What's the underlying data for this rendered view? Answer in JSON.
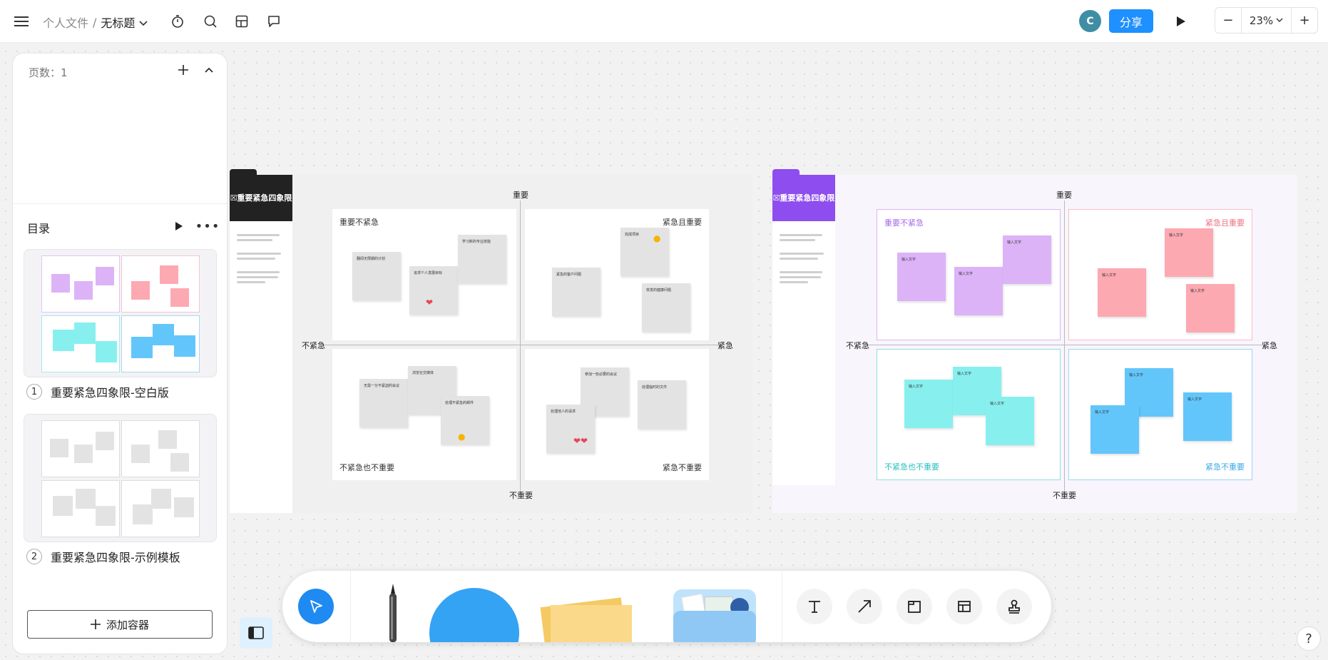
{
  "header": {
    "breadcrumb_root": "个人文件",
    "breadcrumb_sep": "/",
    "document_title": "无标题",
    "avatar_initial": "C",
    "share_label": "分享",
    "zoom_minus": "−",
    "zoom_level": "23%",
    "zoom_plus": "+"
  },
  "sidebar": {
    "page_count": "页数：1",
    "toc_title": "目录",
    "toc_more": "•••",
    "pages": [
      {
        "num": "1",
        "title": "重要紧急四象限-空白版"
      },
      {
        "num": "2",
        "title": "重要紧急四象限-示例模板"
      }
    ],
    "add_container": "添加容器"
  },
  "canvas": {
    "frames": [
      {
        "tab_title": "☒重要紧急四象限",
        "accent": "#222222",
        "axis_top": "重要",
        "axis_bottom": "不重要",
        "axis_left": "不紧急",
        "axis_right": "紧急",
        "q_tl": "重要不紧急",
        "q_tr": "紧急且重要",
        "q_bl": "不紧急也不重要",
        "q_br": "紧急不重要",
        "notes_tl": [
          "翻阅无限期的计划",
          "追求个人发展目标",
          "学习新的专业技能"
        ],
        "notes_tr": [
          "紧急的客户问题",
          "完成项目",
          "突发的健康问题"
        ],
        "notes_bl": [
          "无需一分不紧迫的会议",
          "浏览社交媒体",
          "处理不紧急的邮件"
        ],
        "notes_br": [
          "参加一些必要的会议",
          "处理他人的请求",
          "处理临时的文件"
        ]
      },
      {
        "tab_title": "☒重要紧急四象限",
        "accent": "#8e4dee",
        "axis_top": "重要",
        "axis_bottom": "不重要",
        "axis_left": "不紧急",
        "axis_right": "紧急",
        "q_tl": "重要不紧急",
        "q_tr": "紧急且重要",
        "q_bl": "不紧急也不重要",
        "q_br": "紧急不重要",
        "placeholder": "输入文字"
      }
    ]
  },
  "colors": {
    "accent_blue": "#1e90ff",
    "note_gray": "#e3e3e3",
    "note_purple": "#ddb3f8",
    "note_pink": "#fda9b2",
    "note_cyan": "#87f0ef",
    "note_blue": "#63c6fb"
  }
}
